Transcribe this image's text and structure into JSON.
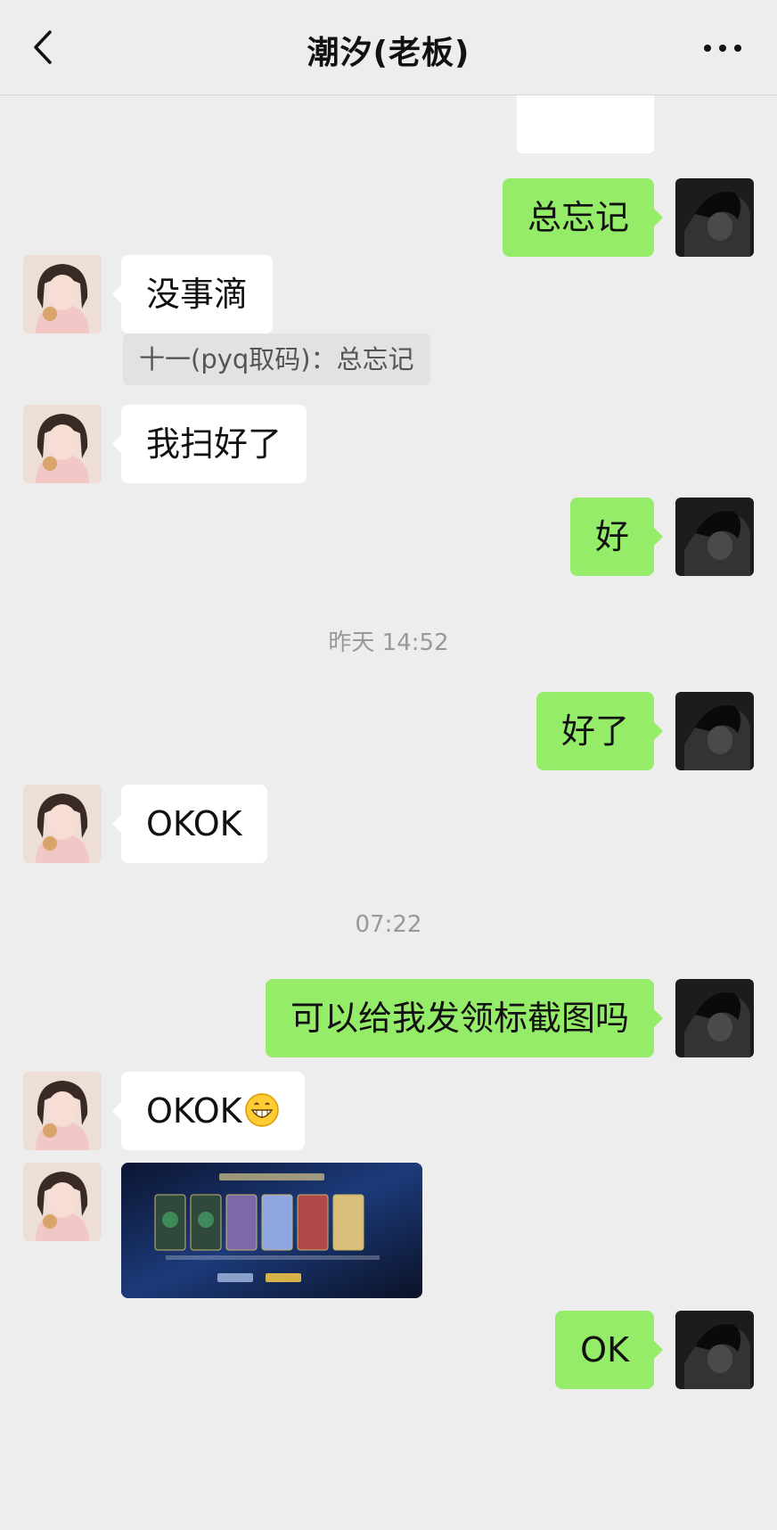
{
  "header": {
    "title": "潮汐(老板)"
  },
  "messages": {
    "m1": "总忘记",
    "m2": "没事滴",
    "m2_quote": "十一(pyq取码)：总忘记",
    "m3": "我扫好了",
    "m4": "好",
    "time1": "昨天 14:52",
    "m5": "好了",
    "m6": "OKOK",
    "time2": "07:22",
    "m7": "可以给我发领标截图吗",
    "m8": "OKOK",
    "m10": "OK"
  },
  "icons": {
    "back": "chevron-left-icon",
    "more": "more-dots-icon",
    "emoji": "grinning-face-emoji-icon"
  },
  "colors": {
    "background": "#ededed",
    "own_bubble": "#95ec69",
    "other_bubble": "#ffffff"
  }
}
